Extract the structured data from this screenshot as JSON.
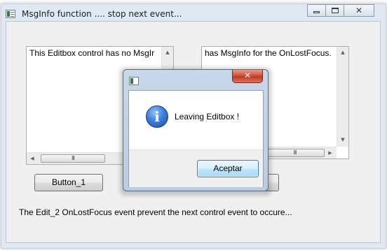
{
  "window": {
    "title": "MsgInfo function .... stop next event...",
    "caption_buttons": {
      "minimize": "minimize-icon",
      "maximize": "maximize-icon",
      "close": "close-icon"
    }
  },
  "edit1": {
    "text": "This Editbox control has no MsgIr"
  },
  "edit2": {
    "text": "has MsgInfo for the OnLostFocus."
  },
  "scrollbar_thumb_grip": "III",
  "buttons": {
    "button1": "Button_1"
  },
  "status_text": "The Edit_2 OnLostFocus event prevent the next control event to occure...",
  "dialog": {
    "close_glyph": "✕",
    "icon": "information-icon",
    "message": "Leaving Editbox !",
    "ok_label": "Aceptar"
  }
}
